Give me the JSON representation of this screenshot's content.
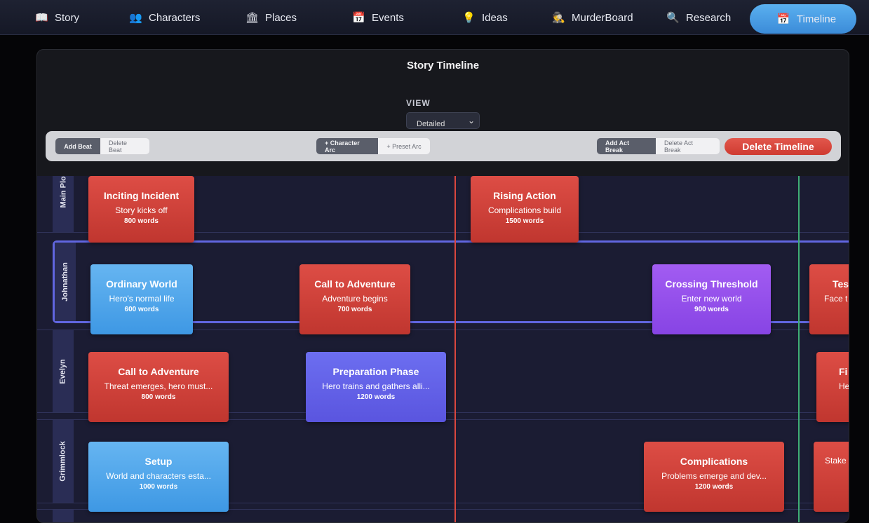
{
  "nav": {
    "items": [
      {
        "icon": "📖",
        "icon_name": "book-icon",
        "label": "Story"
      },
      {
        "icon": "👥",
        "icon_name": "people-icon",
        "label": "Characters"
      },
      {
        "icon": "🏛",
        "icon_name": "building-icon",
        "label": "Places"
      },
      {
        "icon": "📅",
        "icon_name": "calendar-icon",
        "label": "Events"
      },
      {
        "icon": "💡",
        "icon_name": "lightbulb-icon",
        "label": "Ideas"
      },
      {
        "icon": "🕵",
        "icon_name": "detective-icon",
        "label": "MurderBoard"
      },
      {
        "icon": "🔍",
        "icon_name": "magnifier-icon",
        "label": "Research"
      },
      {
        "icon": "📅",
        "icon_name": "calendar-icon",
        "label": "Timeline"
      }
    ],
    "active": "Timeline"
  },
  "panel": {
    "title": "Story Timeline",
    "view_label": "VIEW",
    "view_value": "Detailed"
  },
  "toolbar": {
    "add_beat": "Add Beat",
    "delete_beat": "Delete Beat",
    "character_arc": "+ Character Arc",
    "preset_arc": "+ Preset Arc",
    "add_act_break": "Add Act Break",
    "delete_act_break": "Delete Act Break",
    "delete_timeline": "Delete Timeline"
  },
  "colors": {
    "accent": "#4aa3ea",
    "lane_selected": "#6166e0",
    "marker_red": "#d9473f",
    "marker_green": "#3fae76"
  },
  "lanes": [
    {
      "label": "Main Plot",
      "cards": [
        {
          "title": "Inciting Incident",
          "subtitle": "Story kicks off",
          "words": "800 words",
          "color": "red"
        },
        {
          "title": "Rising Action",
          "subtitle": "Complications build",
          "words": "1500 words",
          "color": "red"
        }
      ]
    },
    {
      "label": "Johnathan",
      "cards": [
        {
          "title": "Ordinary World",
          "subtitle": "Hero's normal life",
          "words": "600 words",
          "color": "blue"
        },
        {
          "title": "Call to Adventure",
          "subtitle": "Adventure begins",
          "words": "700 words",
          "color": "red"
        },
        {
          "title": "Crossing Threshold",
          "subtitle": "Enter new world",
          "words": "900 words",
          "color": "purple"
        },
        {
          "title": "Test",
          "subtitle": "Face t",
          "words": "",
          "color": "red"
        }
      ]
    },
    {
      "label": "Evelyn",
      "cards": [
        {
          "title": "Call to Adventure",
          "subtitle": "Threat emerges, hero must...",
          "words": "800 words",
          "color": "red"
        },
        {
          "title": "Preparation Phase",
          "subtitle": "Hero trains and gathers alli...",
          "words": "1200 words",
          "color": "indigo"
        },
        {
          "title": "Fi",
          "subtitle": "Her",
          "words": "",
          "color": "red"
        }
      ]
    },
    {
      "label": "Grimmlock",
      "cards": [
        {
          "title": "Setup",
          "subtitle": "World and characters esta...",
          "words": "1000 words",
          "color": "blue"
        },
        {
          "title": "Complications",
          "subtitle": "Problems emerge and dev...",
          "words": "1200 words",
          "color": "red"
        },
        {
          "title": "",
          "subtitle": "Stake",
          "words": "",
          "color": "red"
        }
      ]
    }
  ]
}
